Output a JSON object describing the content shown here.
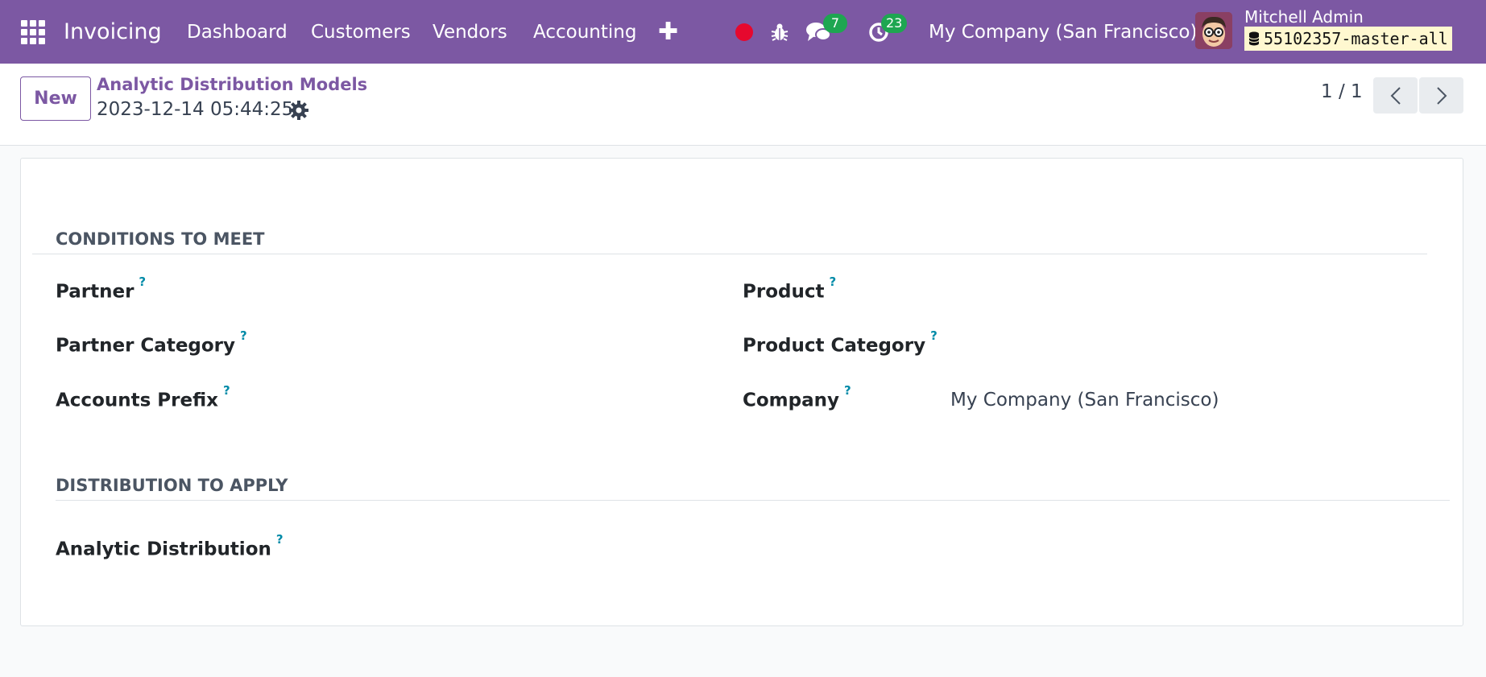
{
  "navbar": {
    "app_name": "Invoicing",
    "menu": [
      "Dashboard",
      "Customers",
      "Vendors",
      "Accounting"
    ],
    "message_count": "7",
    "activity_count": "23",
    "company": "My Company (San Francisco)",
    "user_name": "Mitchell Admin",
    "database": "55102357-master-all",
    "brand_color": "#7c58a3"
  },
  "control_panel": {
    "new_label": "New",
    "breadcrumb": "Analytic Distribution Models",
    "record_name": "2023-12-14 05:44:25",
    "pager": "1 / 1"
  },
  "form": {
    "conditions_title": "CONDITIONS TO MEET",
    "partner_label": "Partner",
    "partner_category_label": "Partner Category",
    "accounts_prefix_label": "Accounts Prefix",
    "product_label": "Product",
    "product_category_label": "Product Category",
    "company_label": "Company",
    "company_value": "My Company (San Francisco)",
    "help_marker": "?",
    "distribution_title": "DISTRIBUTION TO APPLY",
    "analytic_distribution_label": "Analytic Distribution"
  },
  "icons": [
    "apps-icon",
    "plus-icon",
    "record-icon",
    "bug-icon",
    "chat-icon",
    "activity-icon",
    "database-icon",
    "gear-icon",
    "chevron-left-icon",
    "chevron-right-icon"
  ]
}
